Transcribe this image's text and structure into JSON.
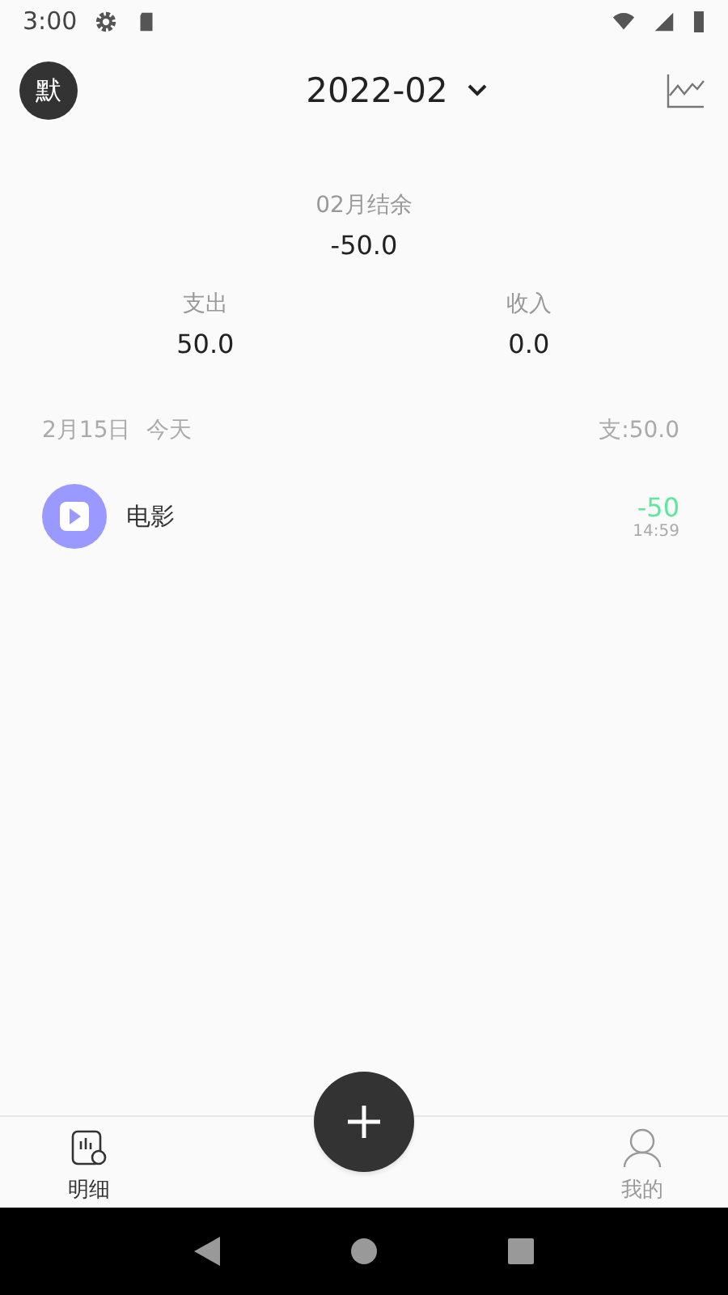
{
  "status_bar": {
    "time": "3:00"
  },
  "header": {
    "avatar": "默",
    "month": "2022-02"
  },
  "summary": {
    "balance_label": "02月结余",
    "balance": "-50.0",
    "expense_label": "支出",
    "expense": "50.0",
    "income_label": "收入",
    "income": "0.0"
  },
  "days": [
    {
      "date": "2月15日",
      "weekday": "今天",
      "total": "支:50.0",
      "entries": [
        {
          "name": "电影",
          "amount": "-50",
          "time": "14:59",
          "color": "#9999ff"
        }
      ]
    }
  ],
  "tabs": [
    {
      "label": "明细",
      "selected": true
    },
    {
      "label": "我的",
      "selected": false
    }
  ]
}
